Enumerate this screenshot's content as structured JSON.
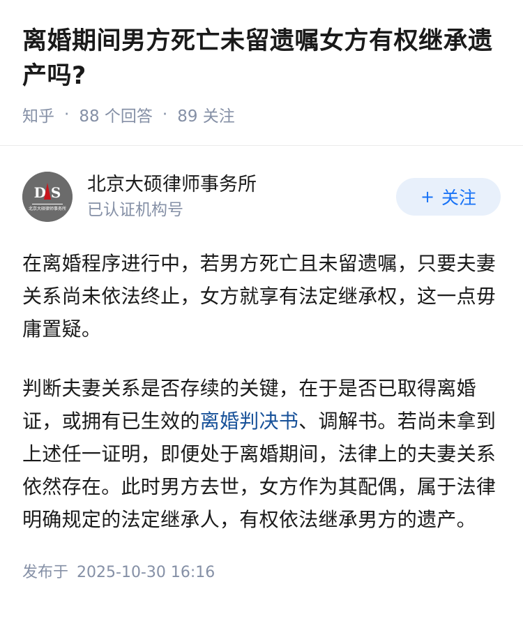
{
  "question": {
    "title": "离婚期间男方死亡未留遗嘱女方有权继承遗产吗?",
    "site": "知乎",
    "answer_count": "88 个回答",
    "follower_count": "89 关注"
  },
  "author": {
    "name": "北京大硕律师事务所",
    "badge": "已认证机构号",
    "avatar_text": "北京大硕律师事务所",
    "avatar_initials": "D S",
    "follow_label": "关注",
    "follow_icon": "plus-icon"
  },
  "answer": {
    "paragraph1": "在离婚程序进行中，若男方死亡且未留遗嘱，只要夫妻关系尚未依法终止，女方就享有法定继承权，这一点毋庸置疑。",
    "paragraph2_before": "判断夫妻关系是否存续的关键，在于是否已取得离婚证，或拥有已生效的",
    "paragraph2_link": "离婚判决书",
    "paragraph2_after": "、调解书。若尚未拿到上述任一证明，即便处于离婚期间，法律上的夫妻关系依然存在。此时男方去世，女方作为其配偶，属于法律明确规定的法定继承人，有权依法继承男方的遗产。",
    "publish_label": "发布于",
    "publish_time": "2025-10-30 16:16"
  },
  "colors": {
    "link": "#175199",
    "follow_text": "#1772f6",
    "follow_bg": "#e8f0fb",
    "meta": "#8590a6",
    "avatar_accent": "#c8161d"
  }
}
